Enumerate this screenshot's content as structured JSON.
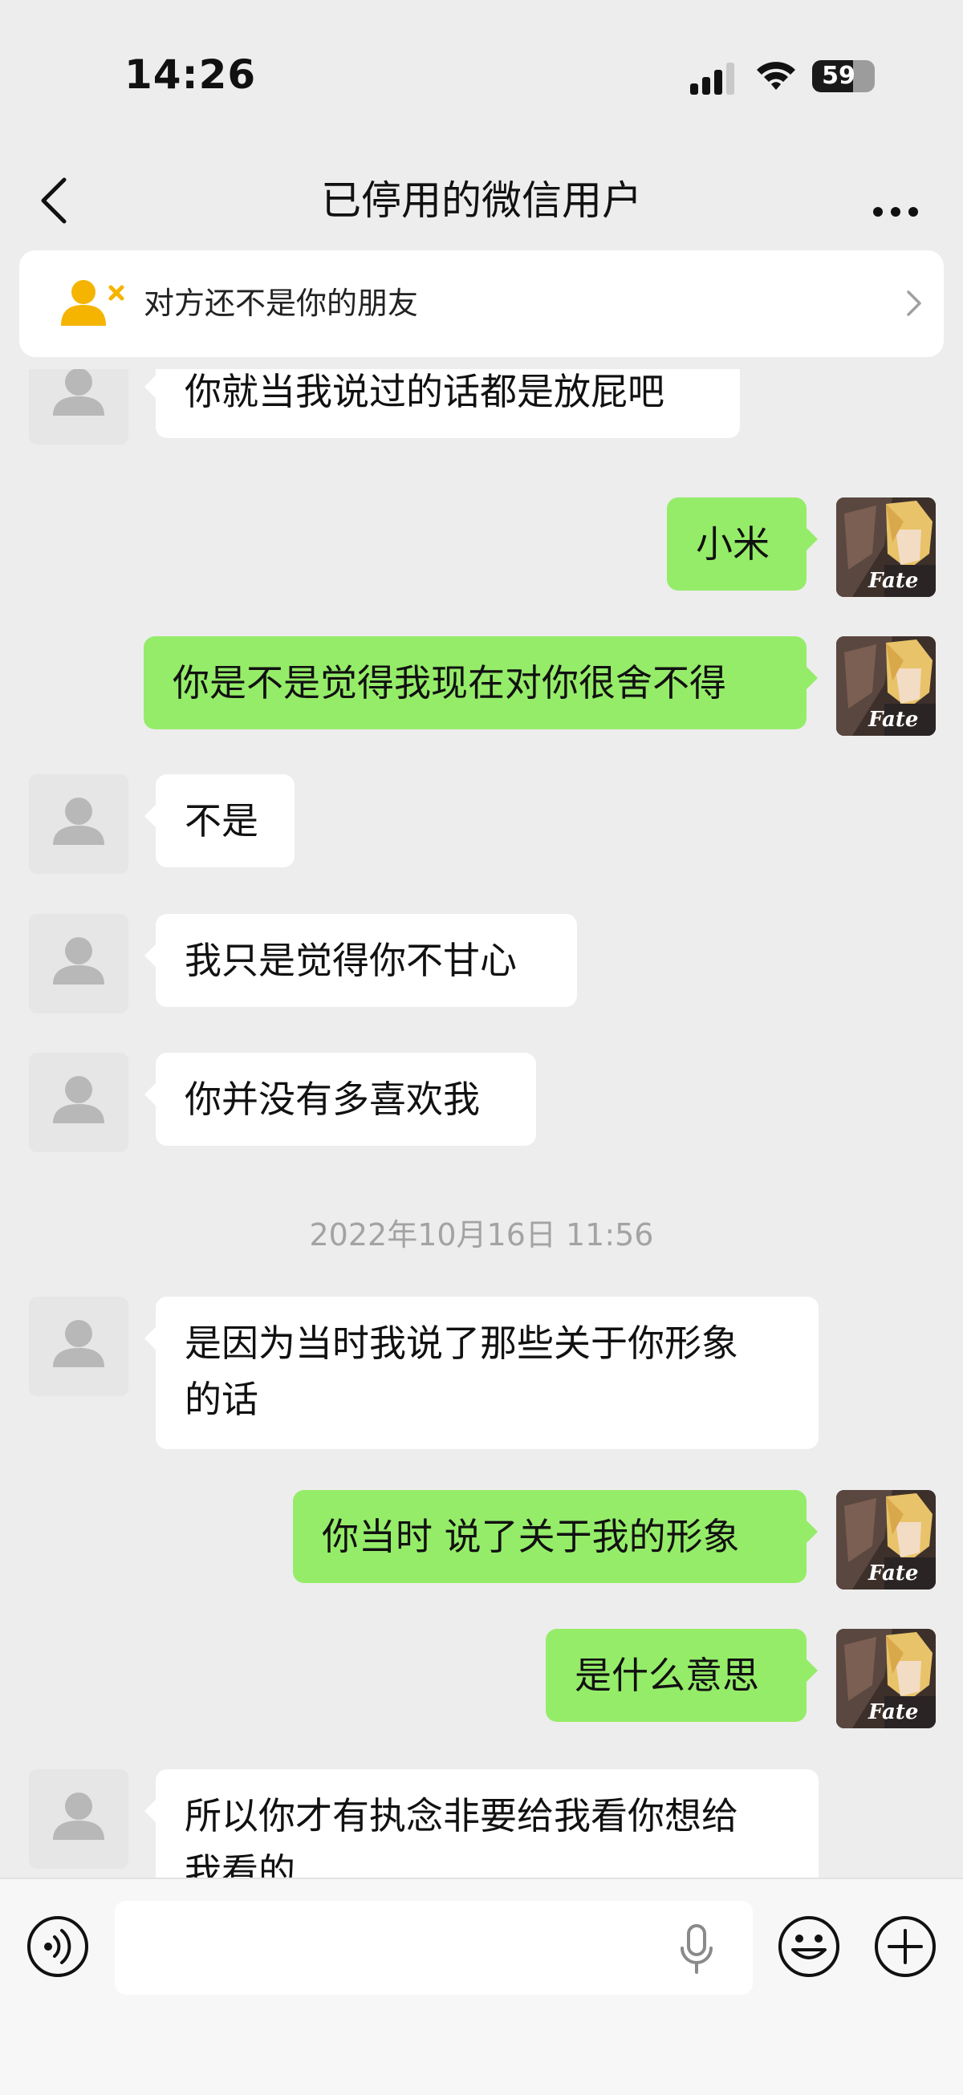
{
  "status_bar": {
    "time": "14:26",
    "battery": "59",
    "battery_level": 0.59
  },
  "header": {
    "title": "已停用的微信用户"
  },
  "notice": {
    "text": "对方还不是你的朋友"
  },
  "messages": [
    {
      "from": "them",
      "text": "你就当我说过的话都是放屁吧"
    },
    {
      "from": "me",
      "text": "小米"
    },
    {
      "from": "me",
      "text": "你是不是觉得我现在对你很舍不得"
    },
    {
      "from": "them",
      "text": "不是"
    },
    {
      "from": "them",
      "text": "我只是觉得你不甘心"
    },
    {
      "from": "them",
      "text": "你并没有多喜欢我"
    },
    {
      "type": "timestamp",
      "text": "2022年10月16日 11:56"
    },
    {
      "from": "them",
      "text": "是因为当时我说了那些关于你形象\n的话"
    },
    {
      "from": "me",
      "text": "你当时 说了关于我的形象"
    },
    {
      "from": "me",
      "text": "是什么意思"
    },
    {
      "from": "them",
      "text": "所以你才有执念非要给我看你想给\n我看的"
    }
  ],
  "input": {
    "value": "",
    "placeholder": ""
  },
  "avatar_text": "Fate",
  "colors": {
    "background": "#ededed",
    "outgoing_bubble": "#95ec69",
    "incoming_bubble": "#ffffff",
    "notice_icon": "#f5b400"
  }
}
